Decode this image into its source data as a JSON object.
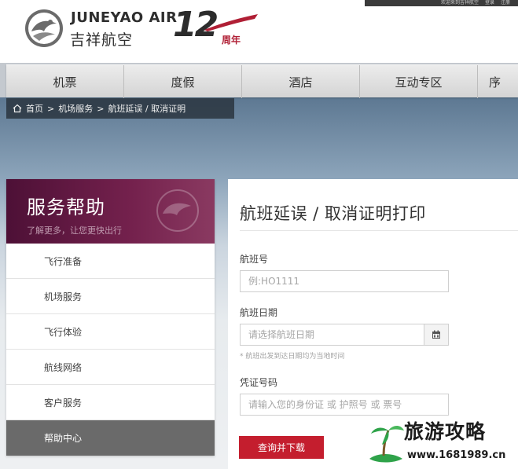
{
  "header": {
    "brand_en": "JUNEYAO AIR",
    "brand_cn": "吉祥航空",
    "anniversary_number": "12",
    "anniversary_unit": "周年",
    "topbar_links": [
      "欢迎来到吉祥航空",
      "登录",
      "注册"
    ]
  },
  "nav": {
    "items": [
      {
        "label": "机票"
      },
      {
        "label": "度假"
      },
      {
        "label": "酒店"
      },
      {
        "label": "互动专区"
      },
      {
        "label": "序"
      }
    ]
  },
  "breadcrumb": {
    "home": "首页",
    "level1": "机场服务",
    "level2": "航班延误 / 取消证明",
    "separator": ">"
  },
  "sidebar": {
    "title": "服务帮助",
    "subtitle": "了解更多，让您更快出行",
    "items": [
      {
        "label": "飞行准备"
      },
      {
        "label": "机场服务"
      },
      {
        "label": "飞行体验"
      },
      {
        "label": "航线网络"
      },
      {
        "label": "客户服务"
      },
      {
        "label": "帮助中心"
      }
    ],
    "active_index": 5
  },
  "form": {
    "title": "航班延误 / 取消证明打印",
    "flight_label": "航班号",
    "flight_placeholder": "例:HO1111",
    "date_label": "航班日期",
    "date_placeholder": "请选择航班日期",
    "date_hint": "* 航班出发到达日期均为当地时间",
    "cert_label": "凭证号码",
    "cert_placeholder": "请输入您的身份证 或 护照号 或 票号",
    "submit_label": "查询并下载"
  },
  "watermark": {
    "text": "旅游攻略",
    "url": "www.1681989.cn"
  },
  "colors": {
    "brand_red": "#c41e2e",
    "sidebar_purple": "#5e1740",
    "active_gray": "#6a6a6a"
  }
}
